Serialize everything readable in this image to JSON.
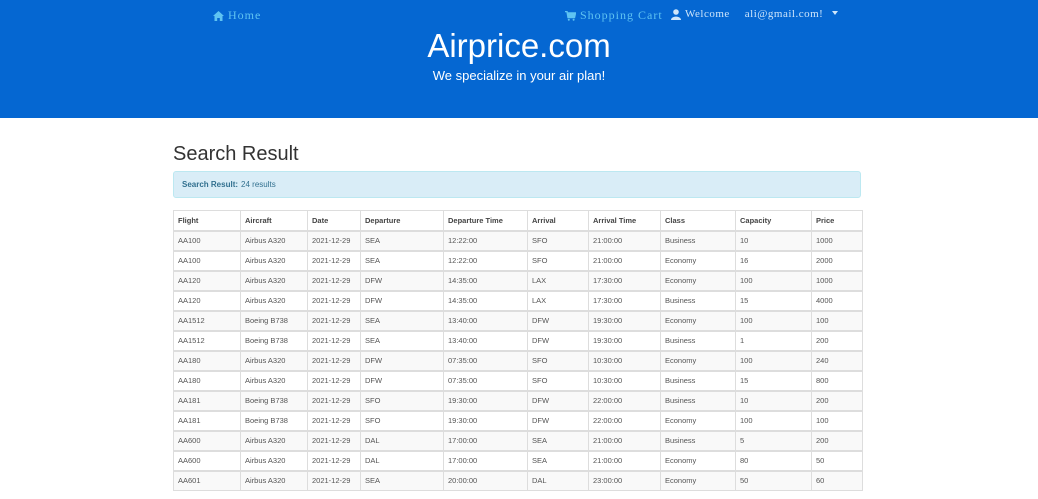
{
  "nav": {
    "home_label": "Home",
    "cart_label": "Shopping Cart",
    "welcome_label": "Welcome",
    "email": "ali@gmail.com!"
  },
  "header": {
    "brand": "Airprice.com",
    "tagline": "We specialize in your air plan!"
  },
  "main": {
    "title": "Search Result",
    "alert_prefix": "Search Result:",
    "alert_text": "24 results"
  },
  "table": {
    "columns": [
      "Flight",
      "Aircraft",
      "Date",
      "Departure",
      "Departure Time",
      "Arrival",
      "Arrival Time",
      "Class",
      "Capacity",
      "Price"
    ],
    "rows": [
      [
        "AA100",
        "Airbus A320",
        "2021-12-29",
        "SEA",
        "12:22:00",
        "SFO",
        "21:00:00",
        "Business",
        "10",
        "1000"
      ],
      [
        "AA100",
        "Airbus A320",
        "2021-12-29",
        "SEA",
        "12:22:00",
        "SFO",
        "21:00:00",
        "Economy",
        "16",
        "2000"
      ],
      [
        "AA120",
        "Airbus A320",
        "2021-12-29",
        "DFW",
        "14:35:00",
        "LAX",
        "17:30:00",
        "Economy",
        "100",
        "1000"
      ],
      [
        "AA120",
        "Airbus A320",
        "2021-12-29",
        "DFW",
        "14:35:00",
        "LAX",
        "17:30:00",
        "Business",
        "15",
        "4000"
      ],
      [
        "AA1512",
        "Boeing B738",
        "2021-12-29",
        "SEA",
        "13:40:00",
        "DFW",
        "19:30:00",
        "Economy",
        "100",
        "100"
      ],
      [
        "AA1512",
        "Boeing B738",
        "2021-12-29",
        "SEA",
        "13:40:00",
        "DFW",
        "19:30:00",
        "Business",
        "1",
        "200"
      ],
      [
        "AA180",
        "Airbus A320",
        "2021-12-29",
        "DFW",
        "07:35:00",
        "SFO",
        "10:30:00",
        "Economy",
        "100",
        "240"
      ],
      [
        "AA180",
        "Airbus A320",
        "2021-12-29",
        "DFW",
        "07:35:00",
        "SFO",
        "10:30:00",
        "Business",
        "15",
        "800"
      ],
      [
        "AA181",
        "Boeing B738",
        "2021-12-29",
        "SFO",
        "19:30:00",
        "DFW",
        "22:00:00",
        "Business",
        "10",
        "200"
      ],
      [
        "AA181",
        "Boeing B738",
        "2021-12-29",
        "SFO",
        "19:30:00",
        "DFW",
        "22:00:00",
        "Economy",
        "100",
        "100"
      ],
      [
        "AA600",
        "Airbus A320",
        "2021-12-29",
        "DAL",
        "17:00:00",
        "SEA",
        "21:00:00",
        "Business",
        "5",
        "200"
      ],
      [
        "AA600",
        "Airbus A320",
        "2021-12-29",
        "DAL",
        "17:00:00",
        "SEA",
        "21:00:00",
        "Economy",
        "80",
        "50"
      ],
      [
        "AA601",
        "Airbus A320",
        "2021-12-29",
        "SEA",
        "20:00:00",
        "DAL",
        "23:00:00",
        "Economy",
        "50",
        "60"
      ]
    ]
  },
  "icons": {
    "home": "home-icon",
    "cart": "shopping-cart-icon",
    "user": "user-icon",
    "caret": "caret-down-icon"
  },
  "colors": {
    "header_bg": "#0567d2",
    "nav_link": "#5fc3f2",
    "alert_bg": "#d9edf7",
    "alert_text": "#31708f"
  }
}
